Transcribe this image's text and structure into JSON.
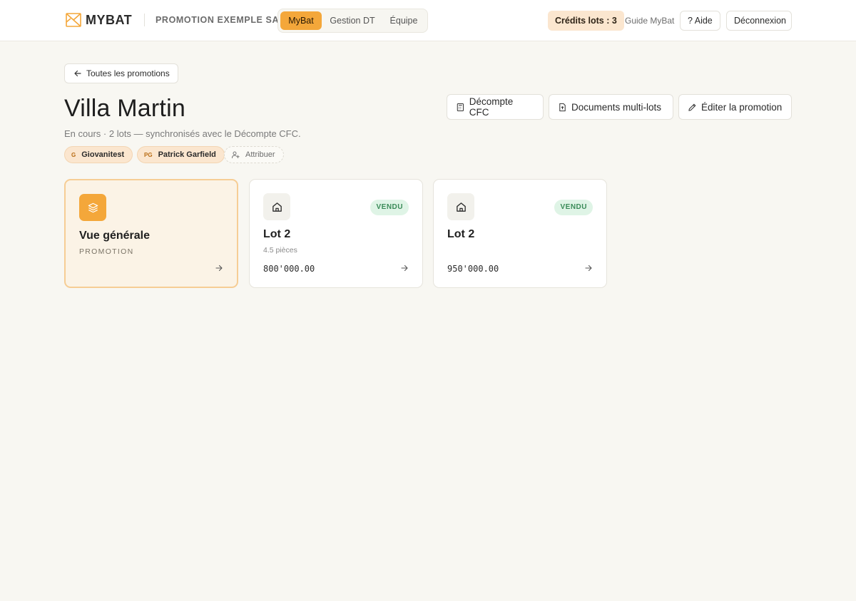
{
  "header": {
    "logo_text": "MYBAT",
    "company": "PROMOTION EXEMPLE SA",
    "tabs": [
      {
        "label": "MyBat",
        "active": true
      },
      {
        "label": "Gestion DT",
        "active": false
      },
      {
        "label": "Équipe",
        "active": false
      }
    ],
    "credits": "Crédits lots : 3",
    "guide": "Guide MyBat",
    "help": "? Aide",
    "logout": "Déconnexion"
  },
  "back_label": "Toutes les promotions",
  "promotion": {
    "title": "Villa Martin",
    "subtitle": "En cours · 2 lots — synchronisés avec le Décompte CFC."
  },
  "actions": {
    "decompte": "Décompte CFC",
    "documents": "Documents multi-lots",
    "edit": "Éditer la promotion"
  },
  "members": [
    {
      "initials": "G",
      "name": "Giovanitest"
    },
    {
      "initials": "PG",
      "name": "Patrick Garfield"
    }
  ],
  "assign_label": "Attribuer",
  "cards": {
    "overview": {
      "title": "Vue générale",
      "subtitle": "PROMOTION"
    },
    "lots": [
      {
        "title": "Lot 2",
        "rooms": "4.5 pièces",
        "price": "800'000.00",
        "status": "VENDU"
      },
      {
        "title": "Lot 2",
        "rooms": "",
        "price": "950'000.00",
        "status": "VENDU"
      }
    ]
  },
  "colors": {
    "accent": "#f4a73a",
    "sold_bg": "#dff4e6",
    "sold_text": "#3a8b58",
    "background": "#f8f7f2"
  }
}
